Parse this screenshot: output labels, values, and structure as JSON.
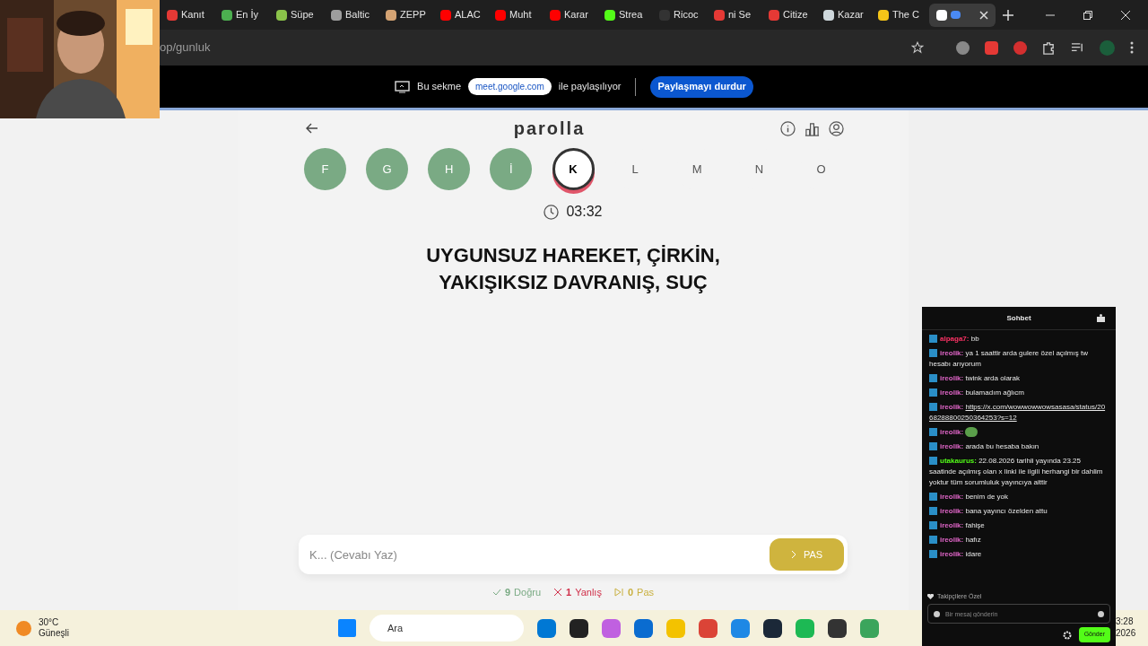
{
  "browser": {
    "tabs": [
      {
        "label": "Kanıt",
        "color": "#e53935",
        "selected": false
      },
      {
        "label": "En İy",
        "color": "#4caf50",
        "selected": false
      },
      {
        "label": "Süpe",
        "color": "#8bc34a",
        "selected": false
      },
      {
        "label": "Baltic",
        "color": "#9e9e9e",
        "selected": false
      },
      {
        "label": "ZEPP",
        "color": "#d4a373",
        "selected": false
      },
      {
        "label": "ALAC",
        "color": "#ff0000",
        "selected": false
      },
      {
        "label": "Muht",
        "color": "#ff0000",
        "selected": false
      },
      {
        "label": "Karar",
        "color": "#ff0000",
        "selected": false
      },
      {
        "label": "Strea",
        "color": "#53fc18",
        "selected": false
      },
      {
        "label": "Ricoc",
        "color": "#333333",
        "selected": false
      },
      {
        "label": "ni Se",
        "color": "#e53935",
        "selected": false
      },
      {
        "label": "Citize",
        "color": "#e53935",
        "selected": false
      },
      {
        "label": "Kazar",
        "color": "#cfd8dc",
        "selected": false
      },
      {
        "label": "The C",
        "color": "#f5c518",
        "selected": false
      },
      {
        "color": "#ffffff",
        "selected": true
      }
    ],
    "address": {
      "faded": "op/",
      "path": "gunluk"
    },
    "share_bar": {
      "prefix": "Bu sekme",
      "site": "meet.google.com",
      "suffix": "ile paylaşılıyor",
      "stop_button": "Paylaşmayı durdur"
    }
  },
  "game": {
    "title": "parolla",
    "letters": [
      {
        "letter": "F",
        "kind": "correct"
      },
      {
        "letter": "G",
        "kind": "correct"
      },
      {
        "letter": "H",
        "kind": "correct"
      },
      {
        "letter": "İ",
        "kind": "correct"
      },
      {
        "letter": "K",
        "kind": "current"
      },
      {
        "letter": "L",
        "kind": "pending"
      },
      {
        "letter": "M",
        "kind": "pending"
      },
      {
        "letter": "N",
        "kind": "pending"
      },
      {
        "letter": "O",
        "kind": "pending"
      }
    ],
    "timer": "03:32",
    "question": "UYGUNSUZ HAREKET, ÇİRKİN, YAKIŞIKSIZ DAVRANIŞ, SUÇ",
    "answer": {
      "placeholder": "K... (Cevabı Yaz)"
    },
    "pass_button": "PAS",
    "stats": [
      {
        "kind": "correct",
        "count": "9",
        "label": "Doğru"
      },
      {
        "kind": "wrong",
        "count": "1",
        "label": "Yanlış"
      },
      {
        "kind": "pass",
        "count": "0",
        "label": "Pas"
      }
    ]
  },
  "chat": {
    "title": "Sohbet",
    "messages": [
      {
        "kind": "text",
        "user": "alpaga7:",
        "color": "#ff3366",
        "text": "bb"
      },
      {
        "kind": "text",
        "user": "ireolik:",
        "color": "#e065c8",
        "text": "ya 1 saattir arda gulere özel açılmış tw hesabı arıyorum"
      },
      {
        "kind": "text",
        "user": "ireolik:",
        "color": "#e065c8",
        "text": "twink arda olarak"
      },
      {
        "kind": "text",
        "user": "ireolik:",
        "color": "#e065c8",
        "text": "bulamadım ağlıcm"
      },
      {
        "kind": "link",
        "user": "ireolik:",
        "color": "#e065c8",
        "text": "https://x.com/wowwowwowsasasa/status/2068288800250364253?s=12"
      },
      {
        "kind": "emote",
        "user": "ireolik:",
        "color": "#e065c8"
      },
      {
        "kind": "text",
        "user": "ireolik:",
        "color": "#e065c8",
        "text": "arada bu hesaba bakın"
      },
      {
        "kind": "text",
        "user": "utakaurus:",
        "color": "#53fc18",
        "text": "22.08.2026 tarihli yayında 23.25 saatinde açılmış olan x linki ile ilgili herhangi bir dahlim yoktur tüm sorumluluk yayıncıya aittir"
      },
      {
        "kind": "text",
        "user": "ireolik:",
        "color": "#e065c8",
        "text": "benim de yok"
      },
      {
        "kind": "text",
        "user": "ireolik:",
        "color": "#e065c8",
        "text": "bana yayıncı özelden attu"
      },
      {
        "kind": "text",
        "user": "ireolik:",
        "color": "#e065c8",
        "text": "fahişe"
      },
      {
        "kind": "text",
        "user": "ireolik:",
        "color": "#e065c8",
        "text": "hafız"
      },
      {
        "kind": "text",
        "user": "ireolik:",
        "color": "#e065c8",
        "text": "idare"
      }
    ],
    "followers_only": "Takipçilere Özel",
    "input": {
      "placeholder": "Bir mesaj gönderin"
    },
    "send_button": "Gönder"
  },
  "taskbar": {
    "weather": {
      "temp": "30°C",
      "condition": "Güneşli"
    },
    "search": {
      "placeholder": "Ara"
    },
    "clock": {
      "time": "3:28",
      "year": "2026"
    }
  }
}
